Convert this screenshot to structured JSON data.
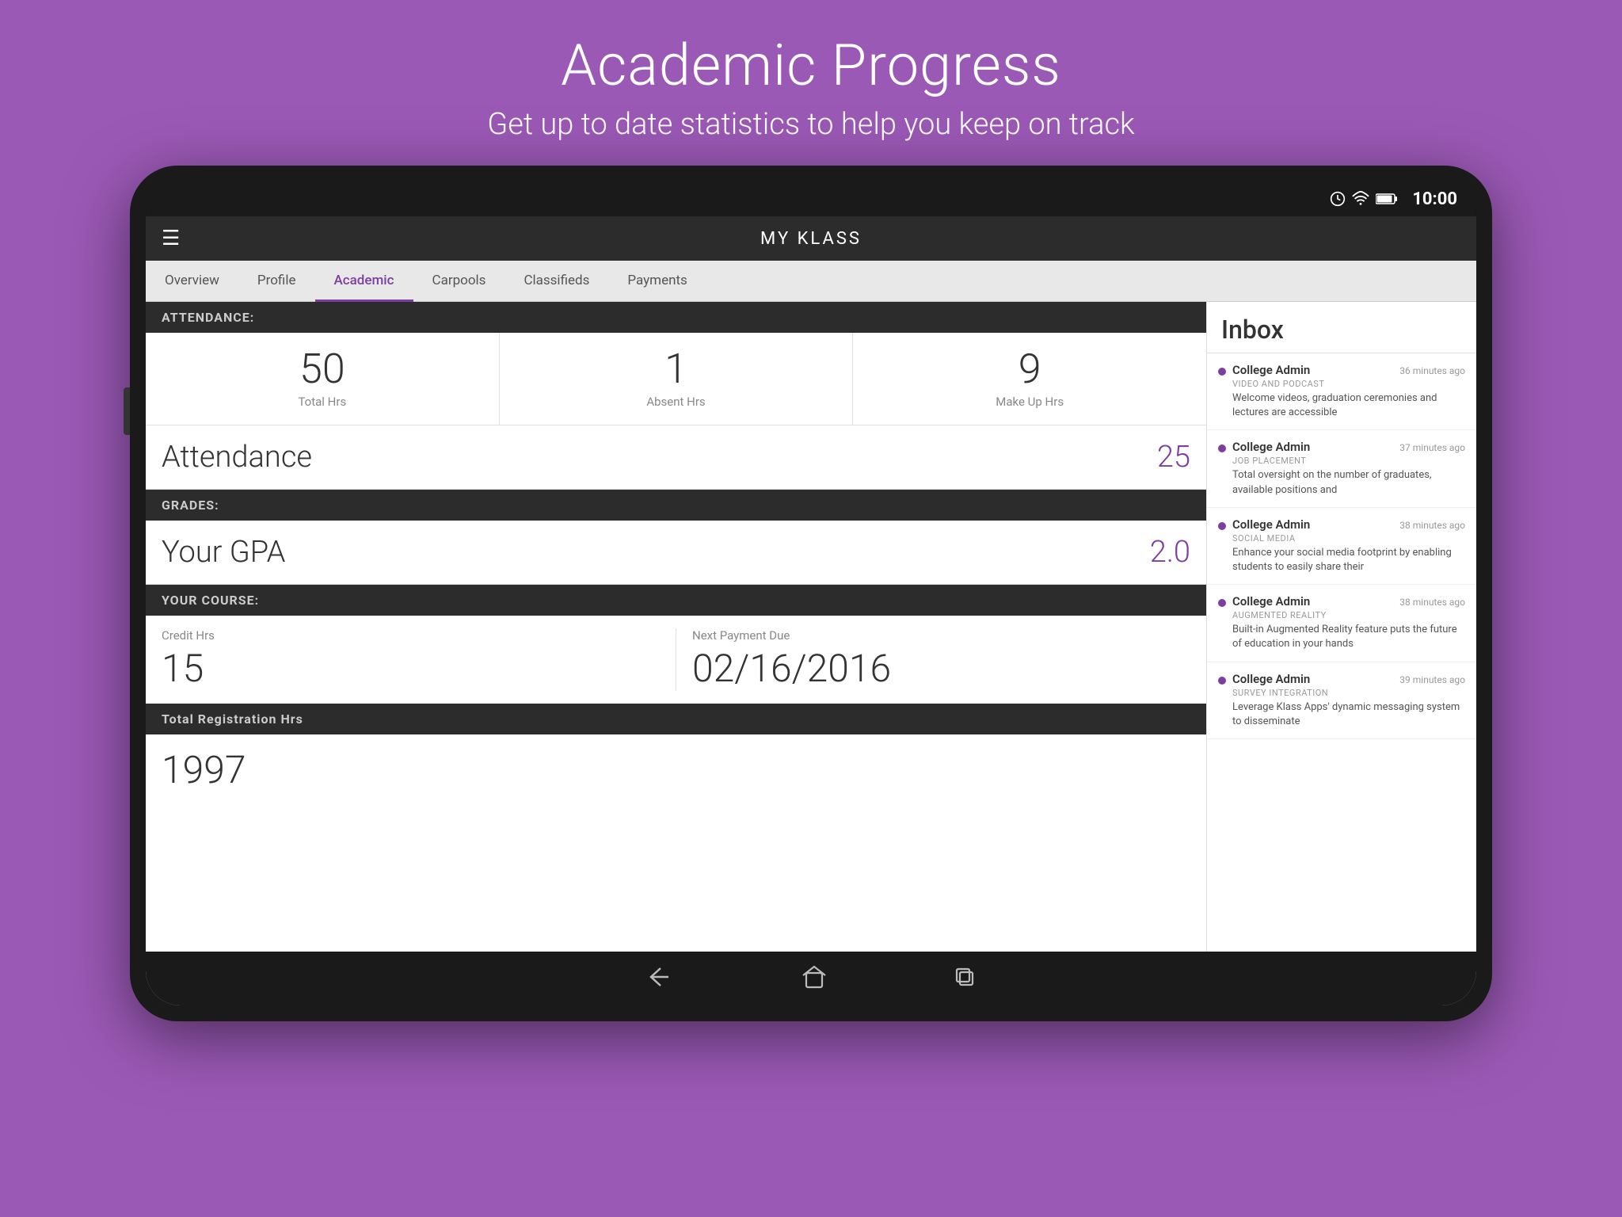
{
  "page": {
    "title": "Academic Progress",
    "subtitle": "Get up to date statistics to help you keep on track",
    "bg_color": "#9b59b6"
  },
  "status_bar": {
    "time": "10:00"
  },
  "top_bar": {
    "app_name": "MY KLASS",
    "hamburger_icon": "☰"
  },
  "tabs": [
    {
      "label": "Overview",
      "active": false
    },
    {
      "label": "Profile",
      "active": false
    },
    {
      "label": "Academic",
      "active": true
    },
    {
      "label": "Carpools",
      "active": false
    },
    {
      "label": "Classifieds",
      "active": false
    },
    {
      "label": "Payments",
      "active": false
    }
  ],
  "attendance_section": {
    "header": "ATTENDANCE:",
    "stats": [
      {
        "value": "50",
        "label": "Total Hrs"
      },
      {
        "value": "1",
        "label": "Absent Hrs"
      },
      {
        "value": "9",
        "label": "Make Up Hrs"
      }
    ],
    "title": "Attendance",
    "score": "25"
  },
  "grades_section": {
    "header": "GRADES:",
    "gpa_label": "Your GPA",
    "gpa_value": "2.0"
  },
  "course_section": {
    "header": "YOUR COURSE:",
    "credit_label": "Credit Hrs",
    "credit_value": "15",
    "payment_label": "Next Payment Due",
    "payment_value": "02/16/2016"
  },
  "partial_section": {
    "label": "Total Registration Hrs",
    "value": "1997"
  },
  "inbox": {
    "title": "Inbox",
    "items": [
      {
        "sender": "College Admin",
        "time": "36 minutes ago",
        "category": "VIDEO AND PODCAST",
        "preview": "Welcome videos, graduation ceremonies and lectures are accessible"
      },
      {
        "sender": "College Admin",
        "time": "37 minutes ago",
        "category": "JOB PLACEMENT",
        "preview": "Total oversight on the number of graduates, available positions and"
      },
      {
        "sender": "College Admin",
        "time": "38 minutes ago",
        "category": "SOCIAL MEDIA",
        "preview": "Enhance your social media footprint by enabling students to easily share their"
      },
      {
        "sender": "College Admin",
        "time": "38 minutes ago",
        "category": "AUGMENTED REALITY",
        "preview": "Built-in Augmented Reality feature puts the future of education in your hands"
      },
      {
        "sender": "College Admin",
        "time": "39 minutes ago",
        "category": "SURVEY INTEGRATION",
        "preview": "Leverage Klass Apps' dynamic messaging system to disseminate"
      }
    ]
  },
  "bottom_nav": {
    "back_icon": "↩",
    "home_icon": "⌂",
    "recent_icon": "▣"
  }
}
